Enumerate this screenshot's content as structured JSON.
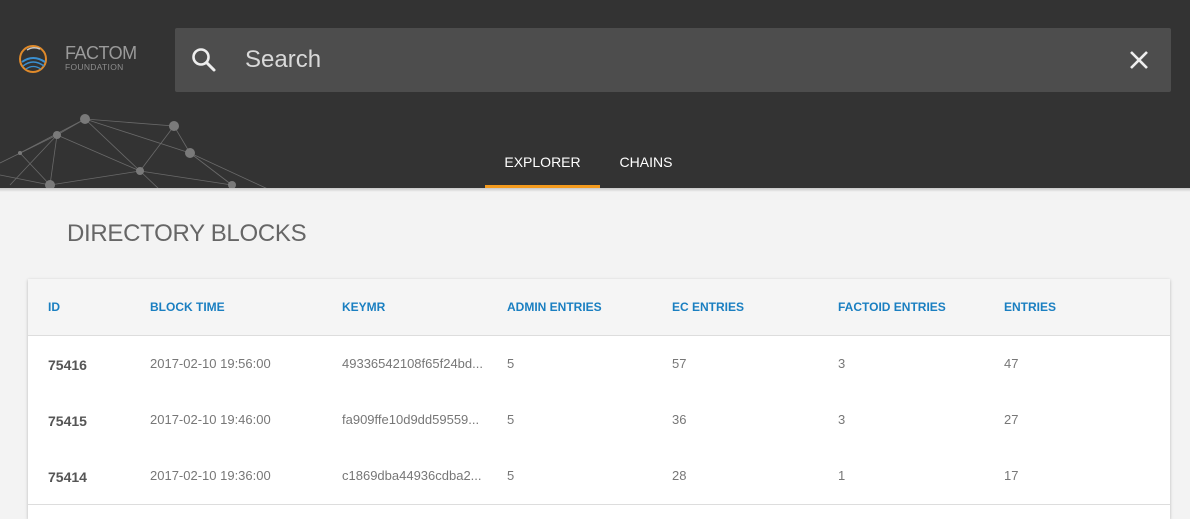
{
  "logo": {
    "name": "FACTOM",
    "sub": "FOUNDATION"
  },
  "search": {
    "placeholder": "Search",
    "value": ""
  },
  "tabs": [
    {
      "label": "EXPLORER",
      "active": true
    },
    {
      "label": "CHAINS",
      "active": false
    }
  ],
  "page": {
    "title": "DIRECTORY BLOCKS"
  },
  "table": {
    "columns": [
      "ID",
      "BLOCK TIME",
      "KEYMR",
      "ADMIN ENTRIES",
      "EC ENTRIES",
      "FACTOID ENTRIES",
      "ENTRIES"
    ],
    "rows": [
      {
        "id": "75416",
        "time": "2017-02-10 19:56:00",
        "keymr": "49336542108f65f24bd...",
        "admin": "5",
        "ec": "57",
        "factoid": "3",
        "entries": "47"
      },
      {
        "id": "75415",
        "time": "2017-02-10 19:46:00",
        "keymr": "fa909ffe10d9dd59559...",
        "admin": "5",
        "ec": "36",
        "factoid": "3",
        "entries": "27"
      },
      {
        "id": "75414",
        "time": "2017-02-10 19:36:00",
        "keymr": "c1869dba44936cdba2...",
        "admin": "5",
        "ec": "28",
        "factoid": "1",
        "entries": "17"
      }
    ]
  },
  "colors": {
    "header": "#333333",
    "accent": "#f39a1d",
    "link": "#1a7fc1"
  },
  "icons": {
    "search": "search-icon",
    "close": "close-icon",
    "logo": "factom-logo-icon"
  }
}
